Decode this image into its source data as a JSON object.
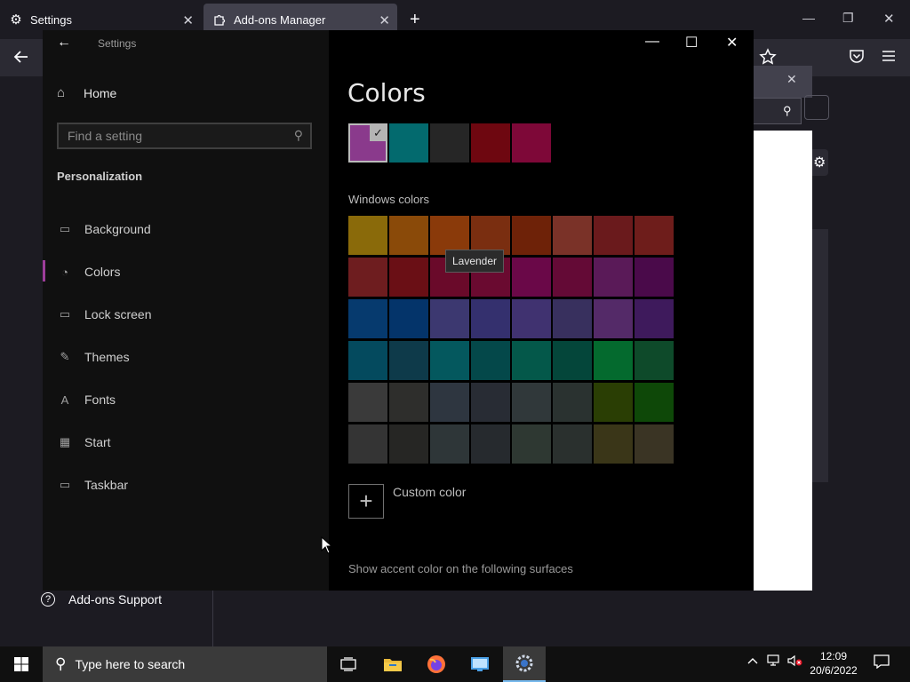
{
  "browser": {
    "tabs": [
      {
        "label": "Settings",
        "icon": "gear-icon",
        "close": "✕"
      },
      {
        "label": "Add-ons Manager",
        "icon": "puzzle-icon",
        "close": "✕"
      }
    ],
    "new_tab": "+",
    "window_controls": {
      "minimize": "—",
      "restore": "❐",
      "close": "✕"
    },
    "addons_support_label": "Add-ons Support",
    "addons_support_icon": "?"
  },
  "settings_window": {
    "title": "Settings",
    "back": "←",
    "controls": {
      "minimize": "—",
      "maximize": "☐",
      "close": "✕"
    },
    "sidebar": {
      "home_label": "Home",
      "search_placeholder": "Find a setting",
      "section_title": "Personalization",
      "items": [
        {
          "label": "Background",
          "icon": "picture-icon",
          "glyph": "▭"
        },
        {
          "label": "Colors",
          "icon": "palette-icon",
          "glyph": "◔",
          "active": true
        },
        {
          "label": "Lock screen",
          "icon": "lock-screen-icon",
          "glyph": "▭"
        },
        {
          "label": "Themes",
          "icon": "brush-icon",
          "glyph": "✎"
        },
        {
          "label": "Fonts",
          "icon": "fonts-icon",
          "glyph": "A"
        },
        {
          "label": "Start",
          "icon": "start-icon",
          "glyph": "▦"
        },
        {
          "label": "Taskbar",
          "icon": "taskbar-icon",
          "glyph": "▭"
        }
      ]
    },
    "content": {
      "title": "Colors",
      "recent_colors": [
        "#8a3a8c",
        "#036a6e",
        "#262626",
        "#6e0710",
        "#7e0838"
      ],
      "selected_recent_index": 0,
      "windows_colors_label": "Windows colors",
      "windows_colors": [
        [
          "#8a6a0a",
          "#8a4a09",
          "#8a3a0a",
          "#7a2e10",
          "#6e2208",
          "#7a3228",
          "#6a1a1c",
          "#6e1d1b"
        ],
        [
          "#6e1d1f",
          "#6a0f15",
          "#6a0a2a",
          "#6a0a30",
          "#6a0848",
          "#640a36",
          "#5a1a58",
          "#4a0a4a"
        ],
        [
          "#063a6e",
          "#04346a",
          "#3c3870",
          "#34306e",
          "#403270",
          "#38305e",
          "#542a68",
          "#3e1a5c"
        ],
        [
          "#044a5e",
          "#0e3a4a",
          "#04585e",
          "#04484a",
          "#04584a",
          "#04463a",
          "#046a2e",
          "#0e4a2a"
        ],
        [
          "#3a3a3a",
          "#2e2e2c",
          "#2e3640",
          "#282c34",
          "#30383a",
          "#2a3230",
          "#2a3e04",
          "#0e4808"
        ],
        [
          "#343434",
          "#262624",
          "#2e3638",
          "#262a2e",
          "#2e3832",
          "#2a302e",
          "#3a3618",
          "#3a3424"
        ]
      ],
      "tooltip": "Lavender",
      "custom_color_label": "Custom color",
      "custom_plus": "+",
      "surfaces_label": "Show accent color on the following surfaces"
    }
  },
  "taskbar": {
    "search_placeholder": "Type here to search",
    "time": "12:09",
    "date": "20/6/2022"
  },
  "colors": {
    "accent": "#9d3d9a",
    "taskbar": "#101010",
    "window_bg": "#000000"
  }
}
